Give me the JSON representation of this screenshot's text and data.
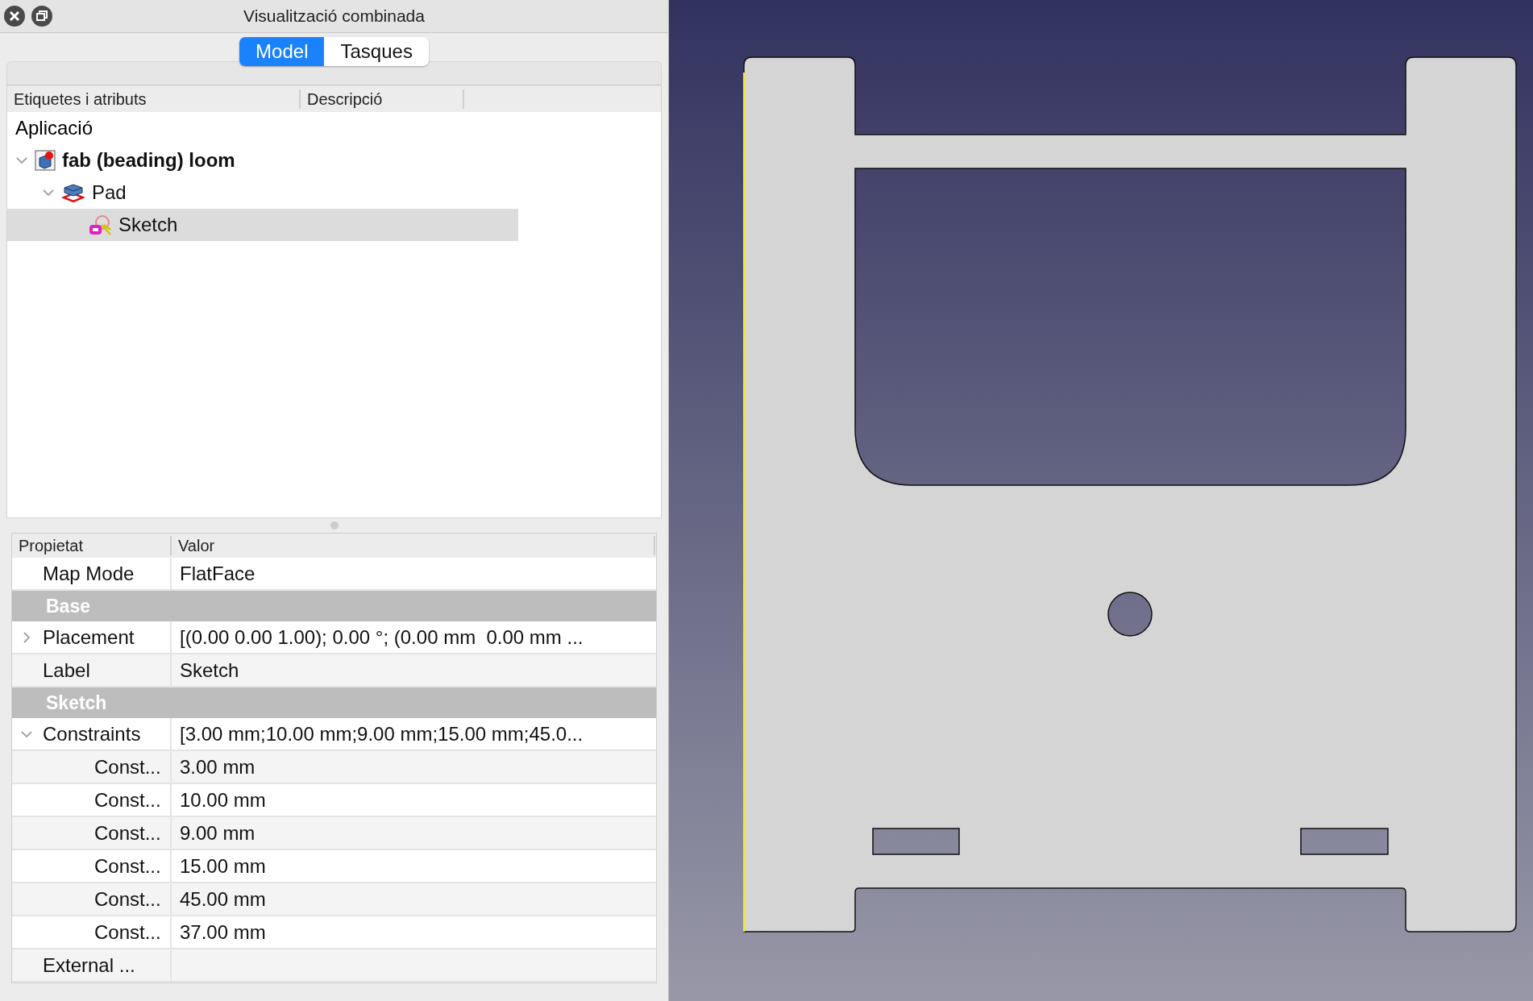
{
  "window": {
    "title": "Visualització combinada"
  },
  "tabs": [
    {
      "label": "Model",
      "selected": true
    },
    {
      "label": "Tasques",
      "selected": false
    }
  ],
  "tree": {
    "columns": [
      "Etiquetes i atributs",
      "Descripció"
    ],
    "root_label": "Aplicació",
    "items": [
      {
        "label": "fab (beading) loom",
        "kind": "document",
        "active": true,
        "selected": false,
        "expanded": true,
        "children": [
          {
            "label": "Pad",
            "kind": "pad",
            "active": false,
            "selected": false,
            "expanded": true,
            "children": [
              {
                "label": "Sketch",
                "kind": "sketch",
                "active": false,
                "selected": true
              }
            ]
          }
        ]
      }
    ]
  },
  "properties": {
    "columns": [
      "Propietat",
      "Valor"
    ],
    "rows": [
      {
        "kind": "property",
        "name": "Map Mode",
        "value": "FlatFace"
      },
      {
        "kind": "group",
        "name": "Base"
      },
      {
        "kind": "property",
        "name": "Placement",
        "value": "[(0.00 0.00 1.00); 0.00 °; (0.00 mm  0.00 mm ...",
        "expanded": false
      },
      {
        "kind": "property",
        "name": "Label",
        "value": "Sketch"
      },
      {
        "kind": "group",
        "name": "Sketch"
      },
      {
        "kind": "property",
        "name": "Constraints",
        "value": "[3.00 mm;10.00 mm;9.00 mm;15.00 mm;45.0...",
        "expanded": true,
        "children": [
          {
            "kind": "property",
            "name": "Const...",
            "value": "3.00 mm"
          },
          {
            "kind": "property",
            "name": "Const...",
            "value": "10.00 mm"
          },
          {
            "kind": "property",
            "name": "Const...",
            "value": "9.00 mm"
          },
          {
            "kind": "property",
            "name": "Const...",
            "value": "15.00 mm"
          },
          {
            "kind": "property",
            "name": "Const...",
            "value": "45.00 mm"
          },
          {
            "kind": "property",
            "name": "Const...",
            "value": "37.00 mm"
          }
        ]
      },
      {
        "kind": "property",
        "name": "External ...",
        "value": ""
      }
    ]
  }
}
